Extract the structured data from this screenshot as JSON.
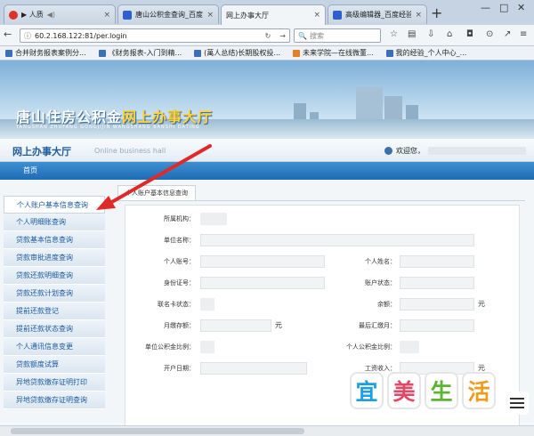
{
  "browser": {
    "tabs": [
      {
        "label": "▶ 人质",
        "active": false
      },
      {
        "label": "唐山公积金查询_百度搜索",
        "active": false
      },
      {
        "label": "网上办事大厅",
        "active": true
      },
      {
        "label": "高级编辑器_百度经验",
        "active": false
      }
    ],
    "url": "60.2.168.122:81/per.login",
    "search_placeholder": "搜索",
    "bookmarks": [
      "合并财务报表案例分...",
      "《财务报表-入门到精...",
      "(萬人总结)长期股权投...",
      "未来学院—在线微董...",
      "我的经验_个人中心_..."
    ]
  },
  "site": {
    "name_a": "唐山住房公积金",
    "name_b": "网上办事大厅",
    "pinyin": "TANGSHAN ZHUFANG GONGJIJIN WANGSHANG BANSHI DATING",
    "hall_title": "网上办事大厅",
    "hall_en": "Online business hall",
    "welcome": "欢迎您，",
    "home": "首页"
  },
  "sidebar": {
    "items": [
      "个人账户基本信息查询",
      "个人明细账查询",
      "贷款基本信息查询",
      "贷款审批进度查询",
      "贷款还款明细查询",
      "贷款还款计划查询",
      "提前还款登记",
      "提前还款状态查询",
      "个人通讯信息变更",
      "贷款额度试算",
      "异地贷款缴存证明打印",
      "异地贷款缴存证明查询"
    ]
  },
  "content": {
    "tab": "个人账户基本信息查询",
    "fields": {
      "org": "所属机构：",
      "unit": "单位名称：",
      "acct": "个人账号：",
      "name": "个人姓名：",
      "idno": "身份证号：",
      "status": "账户状态：",
      "card": "联名卡状态：",
      "balance": "余额：",
      "monthly": "月缴存额：",
      "last": "最后汇缴月：",
      "unit_ratio": "单位公积金比例：",
      "per_ratio": "个人公积金比例：",
      "opendate": "开户日期：",
      "salary": "工资收入："
    },
    "yuan": "元"
  },
  "watermark": [
    "宜",
    "美",
    "生",
    "活"
  ],
  "colors": {
    "accent": "#1e6cb5",
    "arrow": "#e02a2a"
  }
}
